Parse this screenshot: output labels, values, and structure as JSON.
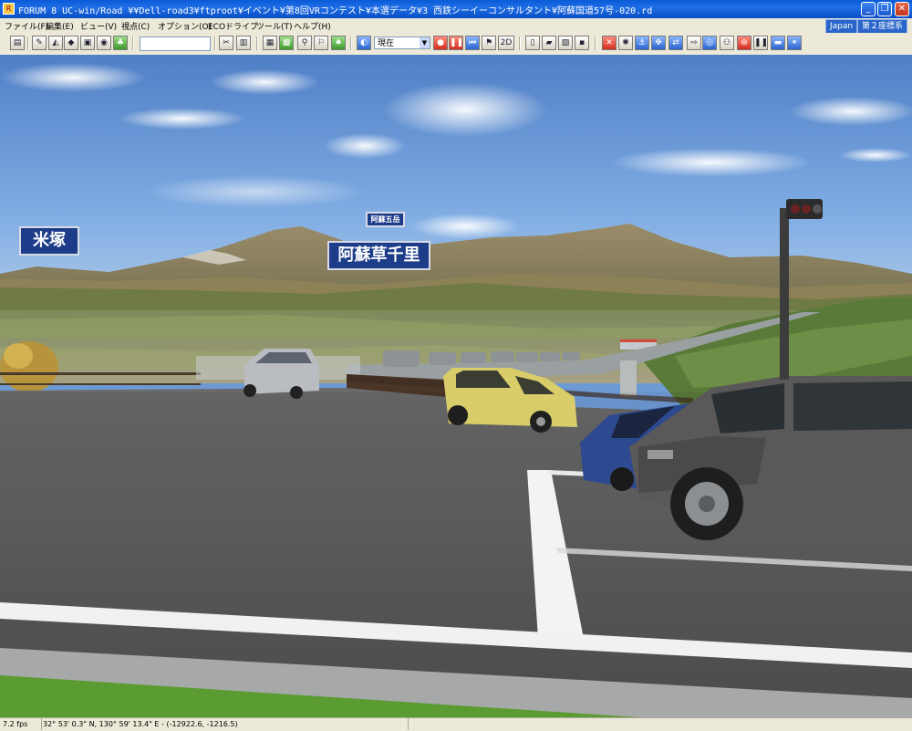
{
  "window": {
    "title": "FORUM 8   UC-win/Road   ¥¥Dell-road3¥ftproot¥イベント¥第8回VRコンテスト¥本選データ¥3 西鉄シーイーコンサルタント¥阿蘇国道57号-020.rd",
    "language_badge": "Japan",
    "coord_badge": "第２座標系"
  },
  "menu": [
    "ファイル(F)",
    "編集(E)",
    "ビュー(V)",
    "視点(C)",
    "オプション(O)",
    "ECOドライブ",
    "ツール(T)",
    "ヘルプ(H)"
  ],
  "toolbar": {
    "search_value": "",
    "viewpoint_select": "現在",
    "mode_2d": "2D"
  },
  "scene": {
    "signs": {
      "left": "米塚",
      "center": "阿蘇草千里",
      "top": "阿蘇五岳"
    }
  },
  "status": {
    "fps": "7.2 fps",
    "position": "32°  53' 0.3\" N, 130°  59' 13.4\" E  -  (-12922.6, -1216.5)"
  }
}
